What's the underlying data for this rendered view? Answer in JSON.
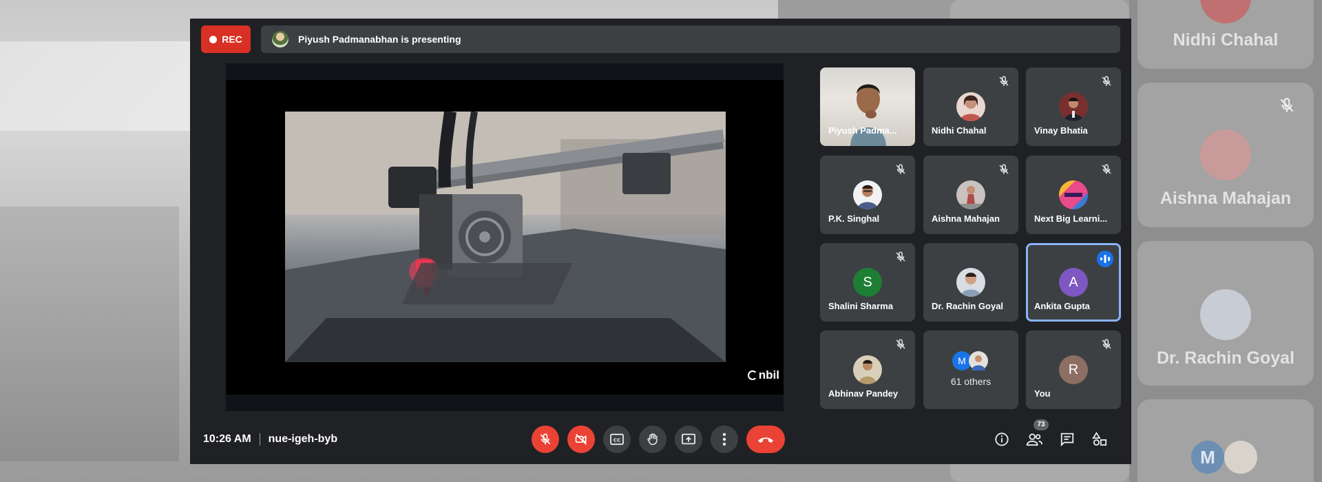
{
  "recording": {
    "label": "REC"
  },
  "presenting": {
    "text": "Piyush Padmanabhan is presenting"
  },
  "watermark": {
    "text": "nbil"
  },
  "participants": [
    {
      "name": "Piyush Padma...",
      "muted": false,
      "kind": "video"
    },
    {
      "name": "Nidhi Chahal",
      "muted": true,
      "kind": "photo",
      "color": "#c0574f"
    },
    {
      "name": "Vinay Bhatia",
      "muted": true,
      "kind": "photo",
      "color": "#8c3a3a"
    },
    {
      "name": "P.K. Singhal",
      "muted": true,
      "kind": "photo",
      "color": "#4a5b8a"
    },
    {
      "name": "Aishna Mahajan",
      "muted": true,
      "kind": "photo",
      "color": "#b04a4a"
    },
    {
      "name": "Next Big Learni...",
      "muted": true,
      "kind": "photo",
      "color": "#d6337a"
    },
    {
      "name": "Shalini Sharma",
      "muted": true,
      "kind": "letter",
      "initial": "S",
      "color": "#1e7e34"
    },
    {
      "name": "Dr. Rachin Goyal",
      "muted": false,
      "kind": "photo",
      "color": "#8aa0b6"
    },
    {
      "name": "Ankita Gupta",
      "muted": false,
      "kind": "letter",
      "initial": "A",
      "color": "#7e57c2",
      "speaking": true
    },
    {
      "name": "Abhinav Pandey",
      "muted": true,
      "kind": "photo",
      "color": "#b59a6a"
    },
    {
      "name": "61 others",
      "kind": "others",
      "mini_initial": "M",
      "mini_color": "#1a73e8"
    },
    {
      "name": "You",
      "muted": true,
      "kind": "letter",
      "initial": "R",
      "color": "#8d6e63"
    }
  ],
  "meeting": {
    "time": "10:26 AM",
    "code": "nue-igeh-byb"
  },
  "people": {
    "count": "73"
  },
  "backdrop": {
    "names": [
      "Nidhi Chahal",
      "Aishna Mahajan",
      "Dr. Rachin Goyal"
    ],
    "initial": "M"
  },
  "colors": {
    "accent": "#8ab4f8",
    "danger": "#ea4335",
    "bg": "#202124",
    "tile": "#3c4043"
  }
}
